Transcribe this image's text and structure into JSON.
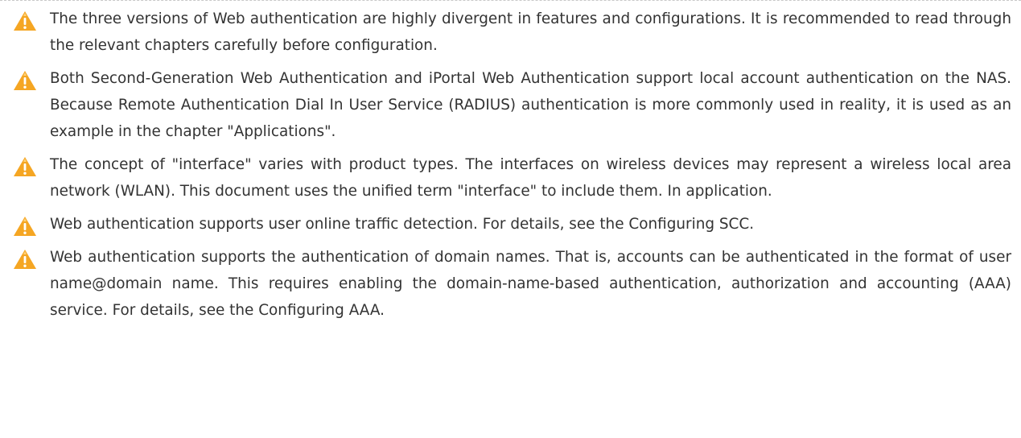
{
  "icon": "warning-triangle-icon",
  "colors": {
    "warning": "#f5a623",
    "text": "#333333"
  },
  "notes": [
    {
      "text": "The three versions of Web authentication are highly divergent in features and configurations. It is recommended to read through the relevant chapters carefully before configuration."
    },
    {
      "text": "Both Second-Generation Web Authentication and iPortal Web Authentication support local account authentication on the NAS. Because Remote Authentication Dial In User Service (RADIUS) authentication is more commonly used in reality, it is used as an example in the chapter \"Applications\"."
    },
    {
      "text": "The concept of \"interface\" varies with product types. The interfaces on wireless devices may represent a wireless local area network (WLAN). This document uses the unified term \"interface\" to include them. In application."
    },
    {
      "text": "Web authentication supports user online traffic detection. For details, see the Configuring SCC."
    },
    {
      "text": "Web authentication supports the authentication of domain names. That is, accounts can be authenticated in the format of user name@domain name. This requires enabling the domain-name-based authentication, authorization and accounting (AAA) service. For details, see the Configuring AAA."
    }
  ]
}
